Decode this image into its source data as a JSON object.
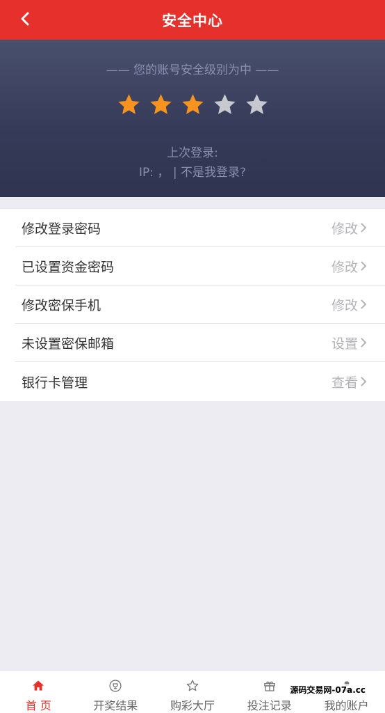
{
  "header": {
    "title": "安全中心",
    "back_icon": "chevron-left-icon"
  },
  "hero": {
    "level_text": "—— 您的账号安全级别为中 ——",
    "stars_filled": 3,
    "stars_total": 5,
    "star_color_filled": "#f7931e",
    "star_color_empty": "#c8c8cf",
    "last_login_label": "上次登录:",
    "ip_text": "IP:  ，  |",
    "not_me_link": "不是我登录?"
  },
  "menu": {
    "items": [
      {
        "label": "修改登录密码",
        "action": "修改"
      },
      {
        "label": "已设置资金密码",
        "action": "修改"
      },
      {
        "label": "修改密保手机",
        "action": "修改"
      },
      {
        "label": "未设置密保邮箱",
        "action": "设置"
      },
      {
        "label": "银行卡管理",
        "action": "查看"
      }
    ]
  },
  "tabbar": {
    "active_color": "#e5302b",
    "tabs": [
      {
        "label": "首 页",
        "icon": "home-icon",
        "active": true
      },
      {
        "label": "开奖结果",
        "icon": "trophy-icon",
        "active": false
      },
      {
        "label": "购彩大厅",
        "icon": "star-outline-icon",
        "active": false
      },
      {
        "label": "投注记录",
        "icon": "gift-icon",
        "active": false
      },
      {
        "label": "我的账户",
        "icon": "user-icon",
        "active": false
      }
    ]
  },
  "watermark": "源码交易网-07a.cc"
}
